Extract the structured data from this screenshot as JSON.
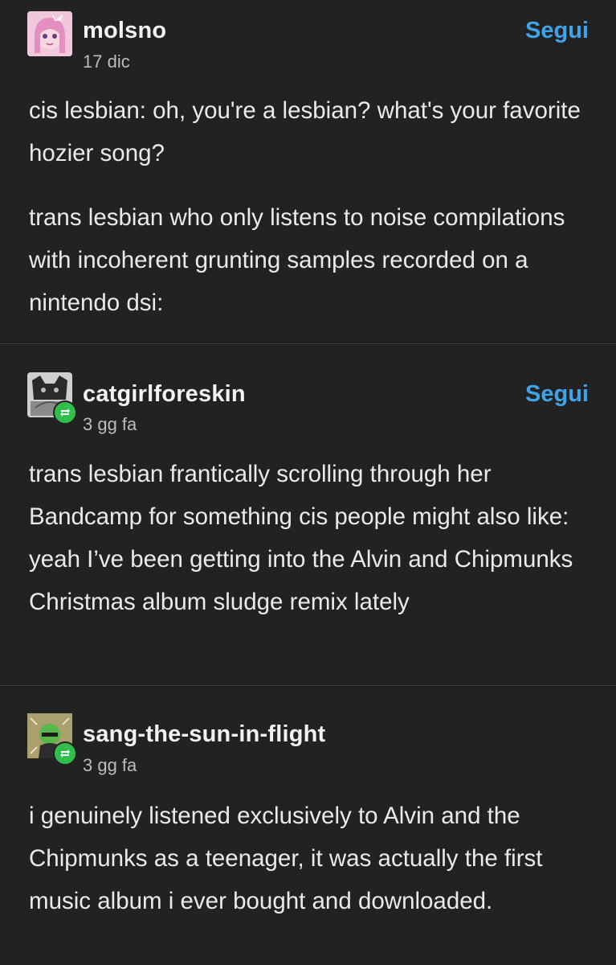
{
  "posts": [
    {
      "username": "molsno",
      "time": "17 dic",
      "follow_label": "Segui",
      "avatar_icon": "pink-anime-girl-avatar-icon",
      "paragraphs": [
        "cis lesbian: oh, you're a lesbian? what's your favorite hozier song?",
        "trans lesbian who only listens to noise compilations with incoherent grunting samples recorded on a nintendo dsi:"
      ]
    },
    {
      "username": "catgirlforeskin",
      "time": "3 gg fa",
      "follow_label": "Segui",
      "avatar_icon": "cat-mask-avatar-icon",
      "reblog_icon": "reblog-icon",
      "paragraphs": [
        "trans lesbian frantically scrolling through her Bandcamp for something cis people might also like: yeah I’ve been getting into the Alvin and Chipmunks Christmas album sludge remix lately"
      ]
    },
    {
      "username": "sang-the-sun-in-flight",
      "time": "3 gg fa",
      "avatar_icon": "green-character-avatar-icon",
      "reblog_icon": "reblog-icon",
      "paragraphs": [
        "i genuinely listened exclusively to Alvin and the Chipmunks as a teenager, it was actually the first music album i ever bought and downloaded."
      ]
    }
  ],
  "colors": {
    "background": "#222222",
    "text": "#eaeaea",
    "follow": "#3fa3e8",
    "reblog": "#2fbf4a"
  }
}
